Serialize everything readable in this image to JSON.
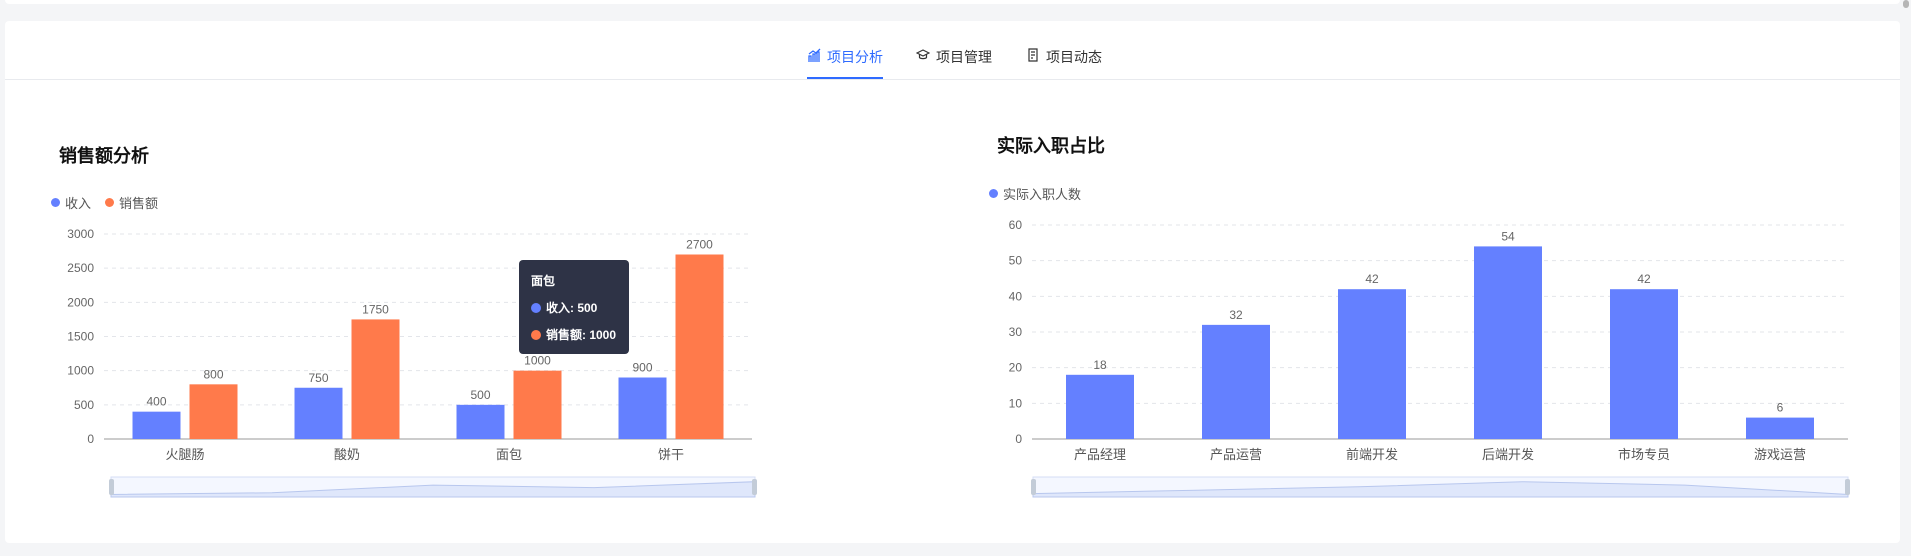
{
  "tabs": [
    {
      "label": "项目分析",
      "icon": "chart-icon",
      "active": true
    },
    {
      "label": "项目管理",
      "icon": "graduation-cap-icon",
      "active": false
    },
    {
      "label": "项目动态",
      "icon": "document-icon",
      "active": false
    }
  ],
  "colors": {
    "income": "#6480ff",
    "sales": "#ff7a4b",
    "accent": "#2f6bff"
  },
  "sales_chart": {
    "title": "销售额分析",
    "legend": [
      "收入",
      "销售额"
    ],
    "tooltip": {
      "title": "面包",
      "income": "收入: 500",
      "sales": "销售额: 1000"
    }
  },
  "hire_chart": {
    "title": "实际入职占比",
    "legend": [
      "实际入职人数"
    ]
  },
  "chart_data": [
    {
      "type": "bar",
      "title": "销售额分析",
      "categories": [
        "火腿肠",
        "酸奶",
        "面包",
        "饼干"
      ],
      "series": [
        {
          "name": "收入",
          "values": [
            400,
            750,
            500,
            900
          ]
        },
        {
          "name": "销售额",
          "values": [
            800,
            1750,
            1000,
            2700
          ]
        }
      ],
      "ylim": [
        0,
        3000
      ],
      "yticks": [
        0,
        500,
        1000,
        1500,
        2000,
        2500,
        3000
      ],
      "grid": true,
      "legend_position": "top-left"
    },
    {
      "type": "bar",
      "title": "实际入职占比",
      "categories": [
        "产品经理",
        "产品运营",
        "前端开发",
        "后端开发",
        "市场专员",
        "游戏运营"
      ],
      "series": [
        {
          "name": "实际入职人数",
          "values": [
            18,
            32,
            42,
            54,
            42,
            6
          ]
        }
      ],
      "ylim": [
        0,
        60
      ],
      "yticks": [
        0,
        10,
        20,
        30,
        40,
        50,
        60
      ],
      "grid": true,
      "legend_position": "top-left"
    }
  ]
}
